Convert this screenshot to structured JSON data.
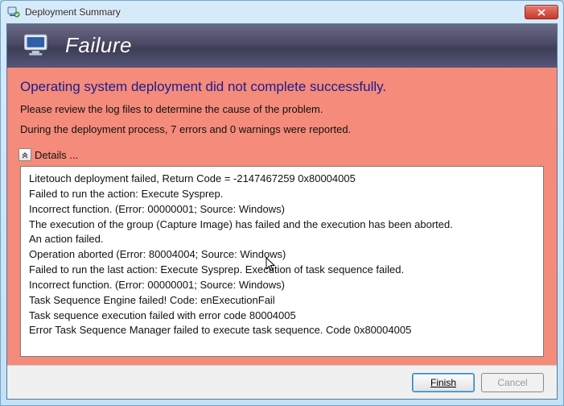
{
  "window": {
    "title": "Deployment Summary"
  },
  "banner": {
    "title": "Failure"
  },
  "error": {
    "heading": "Operating system deployment did not complete successfully.",
    "review_msg": "Please review the log files to determine the cause of the problem.",
    "count_msg": "During the deployment process, 7 errors and 0 warnings were reported.",
    "details_label": "Details ..."
  },
  "log_lines": [
    "Litetouch deployment failed, Return Code = -2147467259  0x80004005",
    "Failed to run the action: Execute Sysprep.",
    "Incorrect function. (Error: 00000001; Source: Windows)",
    "The execution of the group (Capture Image) has failed and the execution has been aborted.",
    "An action failed.",
    "Operation aborted (Error: 80004004; Source: Windows)",
    "Failed to run the last action: Execute Sysprep. Execution of task sequence failed.",
    "Incorrect function. (Error: 00000001; Source: Windows)",
    "Task Sequence Engine failed! Code: enExecutionFail",
    "Task sequence execution failed with error code 80004005",
    "Error Task Sequence Manager failed to execute task sequence. Code 0x80004005"
  ],
  "buttons": {
    "finish": "Finish",
    "cancel": "Cancel"
  }
}
